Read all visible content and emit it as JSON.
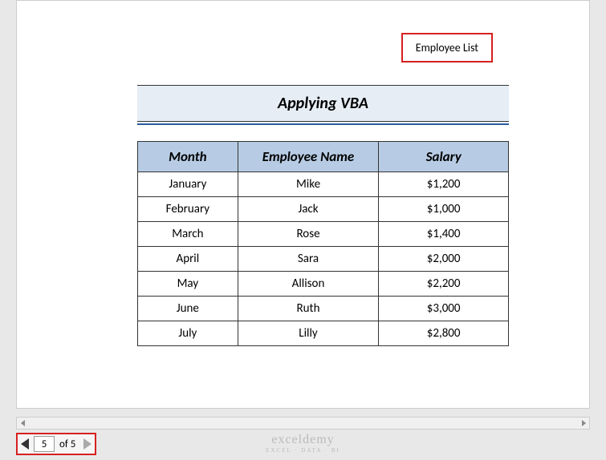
{
  "header": {
    "label": "Employee List"
  },
  "title": "Applying VBA",
  "table": {
    "headers": {
      "month": "Month",
      "name": "Employee Name",
      "salary": "Salary"
    },
    "rows": [
      {
        "month": "January",
        "name": "Mike",
        "salary": "$1,200"
      },
      {
        "month": "February",
        "name": "Jack",
        "salary": "$1,000"
      },
      {
        "month": "March",
        "name": "Rose",
        "salary": "$1,400"
      },
      {
        "month": "April",
        "name": "Sara",
        "salary": "$2,000"
      },
      {
        "month": "May",
        "name": "Allison",
        "salary": "$2,200"
      },
      {
        "month": "June",
        "name": "Ruth",
        "salary": "$3,000"
      },
      {
        "month": "July",
        "name": "Lilly",
        "salary": "$2,800"
      }
    ]
  },
  "pager": {
    "current": "5",
    "of_label": "of 5"
  },
  "watermark": {
    "title": "exceldemy",
    "subtitle": "EXCEL · DATA · BI"
  }
}
